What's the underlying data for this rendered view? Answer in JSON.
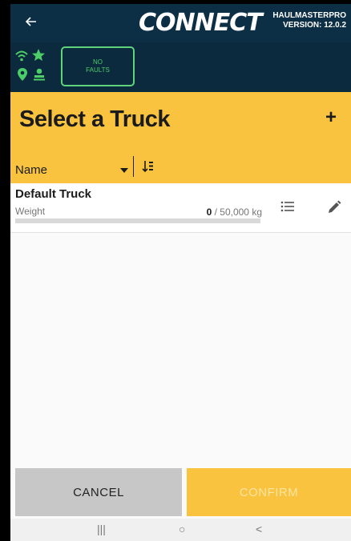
{
  "topbar": {
    "back_icon": "back-arrow-icon",
    "logo_text": "CONNECT",
    "app_name": "HAULMASTERPRO",
    "version": "VERSION: 12.0.2"
  },
  "status": {
    "icons": [
      "wifi-icon",
      "star-icon",
      "location-icon",
      "driver-icon"
    ],
    "status_color": "#4ccd68",
    "faults_line1": "NO",
    "faults_line2": "FAULTS"
  },
  "header": {
    "title": "Select a Truck",
    "add_label": "+",
    "sort_field": "Name"
  },
  "trucks": [
    {
      "name": "Default Truck",
      "weight_label": "Weight",
      "weight_current": "0",
      "weight_max": "/ 50,000 kg",
      "load_fraction": 0
    }
  ],
  "actions": {
    "cancel": "CANCEL",
    "confirm": "CONFIRM"
  },
  "navbar": {
    "recents": "|||",
    "home": "○",
    "back": "<"
  },
  "colors": {
    "brand_dark": "#0d2f45",
    "accent_yellow": "#f9c33f",
    "status_green": "#4ccd68"
  }
}
